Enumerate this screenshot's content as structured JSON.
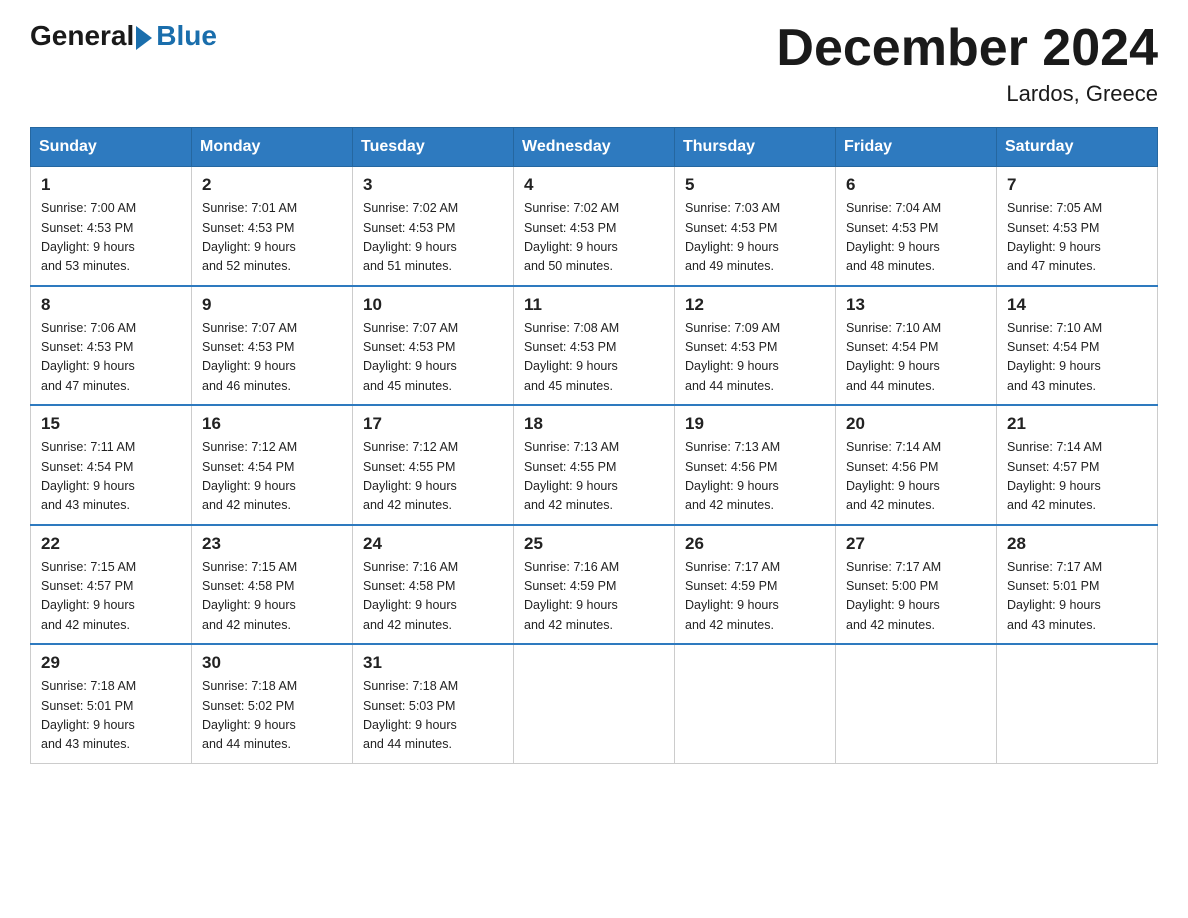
{
  "header": {
    "logo_general": "General",
    "logo_blue": "Blue",
    "month_title": "December 2024",
    "location": "Lardos, Greece"
  },
  "days_of_week": [
    "Sunday",
    "Monday",
    "Tuesday",
    "Wednesday",
    "Thursday",
    "Friday",
    "Saturday"
  ],
  "weeks": [
    [
      {
        "day": "1",
        "sunrise": "7:00 AM",
        "sunset": "4:53 PM",
        "daylight": "9 hours and 53 minutes."
      },
      {
        "day": "2",
        "sunrise": "7:01 AM",
        "sunset": "4:53 PM",
        "daylight": "9 hours and 52 minutes."
      },
      {
        "day": "3",
        "sunrise": "7:02 AM",
        "sunset": "4:53 PM",
        "daylight": "9 hours and 51 minutes."
      },
      {
        "day": "4",
        "sunrise": "7:02 AM",
        "sunset": "4:53 PM",
        "daylight": "9 hours and 50 minutes."
      },
      {
        "day": "5",
        "sunrise": "7:03 AM",
        "sunset": "4:53 PM",
        "daylight": "9 hours and 49 minutes."
      },
      {
        "day": "6",
        "sunrise": "7:04 AM",
        "sunset": "4:53 PM",
        "daylight": "9 hours and 48 minutes."
      },
      {
        "day": "7",
        "sunrise": "7:05 AM",
        "sunset": "4:53 PM",
        "daylight": "9 hours and 47 minutes."
      }
    ],
    [
      {
        "day": "8",
        "sunrise": "7:06 AM",
        "sunset": "4:53 PM",
        "daylight": "9 hours and 47 minutes."
      },
      {
        "day": "9",
        "sunrise": "7:07 AM",
        "sunset": "4:53 PM",
        "daylight": "9 hours and 46 minutes."
      },
      {
        "day": "10",
        "sunrise": "7:07 AM",
        "sunset": "4:53 PM",
        "daylight": "9 hours and 45 minutes."
      },
      {
        "day": "11",
        "sunrise": "7:08 AM",
        "sunset": "4:53 PM",
        "daylight": "9 hours and 45 minutes."
      },
      {
        "day": "12",
        "sunrise": "7:09 AM",
        "sunset": "4:53 PM",
        "daylight": "9 hours and 44 minutes."
      },
      {
        "day": "13",
        "sunrise": "7:10 AM",
        "sunset": "4:54 PM",
        "daylight": "9 hours and 44 minutes."
      },
      {
        "day": "14",
        "sunrise": "7:10 AM",
        "sunset": "4:54 PM",
        "daylight": "9 hours and 43 minutes."
      }
    ],
    [
      {
        "day": "15",
        "sunrise": "7:11 AM",
        "sunset": "4:54 PM",
        "daylight": "9 hours and 43 minutes."
      },
      {
        "day": "16",
        "sunrise": "7:12 AM",
        "sunset": "4:54 PM",
        "daylight": "9 hours and 42 minutes."
      },
      {
        "day": "17",
        "sunrise": "7:12 AM",
        "sunset": "4:55 PM",
        "daylight": "9 hours and 42 minutes."
      },
      {
        "day": "18",
        "sunrise": "7:13 AM",
        "sunset": "4:55 PM",
        "daylight": "9 hours and 42 minutes."
      },
      {
        "day": "19",
        "sunrise": "7:13 AM",
        "sunset": "4:56 PM",
        "daylight": "9 hours and 42 minutes."
      },
      {
        "day": "20",
        "sunrise": "7:14 AM",
        "sunset": "4:56 PM",
        "daylight": "9 hours and 42 minutes."
      },
      {
        "day": "21",
        "sunrise": "7:14 AM",
        "sunset": "4:57 PM",
        "daylight": "9 hours and 42 minutes."
      }
    ],
    [
      {
        "day": "22",
        "sunrise": "7:15 AM",
        "sunset": "4:57 PM",
        "daylight": "9 hours and 42 minutes."
      },
      {
        "day": "23",
        "sunrise": "7:15 AM",
        "sunset": "4:58 PM",
        "daylight": "9 hours and 42 minutes."
      },
      {
        "day": "24",
        "sunrise": "7:16 AM",
        "sunset": "4:58 PM",
        "daylight": "9 hours and 42 minutes."
      },
      {
        "day": "25",
        "sunrise": "7:16 AM",
        "sunset": "4:59 PM",
        "daylight": "9 hours and 42 minutes."
      },
      {
        "day": "26",
        "sunrise": "7:17 AM",
        "sunset": "4:59 PM",
        "daylight": "9 hours and 42 minutes."
      },
      {
        "day": "27",
        "sunrise": "7:17 AM",
        "sunset": "5:00 PM",
        "daylight": "9 hours and 42 minutes."
      },
      {
        "day": "28",
        "sunrise": "7:17 AM",
        "sunset": "5:01 PM",
        "daylight": "9 hours and 43 minutes."
      }
    ],
    [
      {
        "day": "29",
        "sunrise": "7:18 AM",
        "sunset": "5:01 PM",
        "daylight": "9 hours and 43 minutes."
      },
      {
        "day": "30",
        "sunrise": "7:18 AM",
        "sunset": "5:02 PM",
        "daylight": "9 hours and 44 minutes."
      },
      {
        "day": "31",
        "sunrise": "7:18 AM",
        "sunset": "5:03 PM",
        "daylight": "9 hours and 44 minutes."
      },
      null,
      null,
      null,
      null
    ]
  ],
  "labels": {
    "sunrise": "Sunrise:",
    "sunset": "Sunset:",
    "daylight": "Daylight:"
  }
}
